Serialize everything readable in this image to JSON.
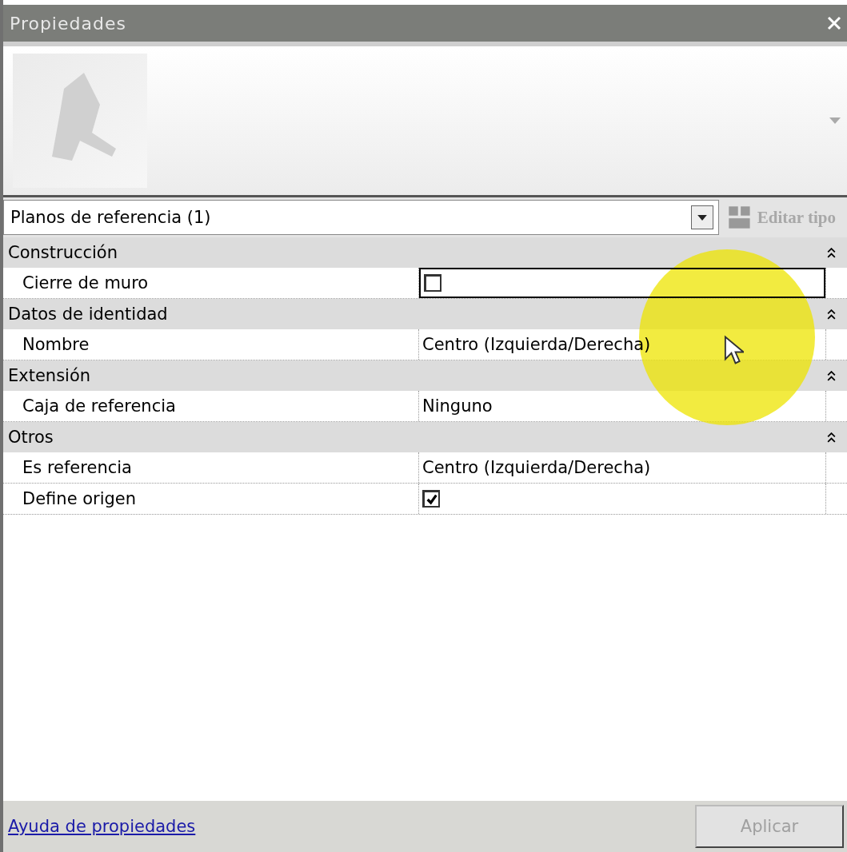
{
  "window": {
    "title": "Propiedades"
  },
  "type_selector": {
    "value": "Planos de referencia (1)"
  },
  "edit_type_button": {
    "label": "Editar tipo",
    "disabled": true
  },
  "groups": [
    {
      "name": "Construcción",
      "expanded": true,
      "properties": [
        {
          "label": "Cierre de muro",
          "kind": "checkbox",
          "checked": false,
          "focused": true
        }
      ]
    },
    {
      "name": "Datos de identidad",
      "expanded": true,
      "properties": [
        {
          "label": "Nombre",
          "kind": "text",
          "value": "Centro (Izquierda/Derecha)",
          "focused": false
        }
      ]
    },
    {
      "name": "Extensión",
      "expanded": true,
      "properties": [
        {
          "label": "Caja de referencia",
          "kind": "text",
          "value": "Ninguno",
          "focused": false
        }
      ]
    },
    {
      "name": "Otros",
      "expanded": true,
      "properties": [
        {
          "label": "Es referencia",
          "kind": "text",
          "value": "Centro (Izquierda/Derecha)",
          "focused": false
        },
        {
          "label": "Define origen",
          "kind": "checkbox",
          "checked": true,
          "focused": false
        }
      ]
    }
  ],
  "footer": {
    "help_link": "Ayuda de propiedades",
    "apply_button": {
      "label": "Aplicar",
      "disabled": true
    }
  }
}
